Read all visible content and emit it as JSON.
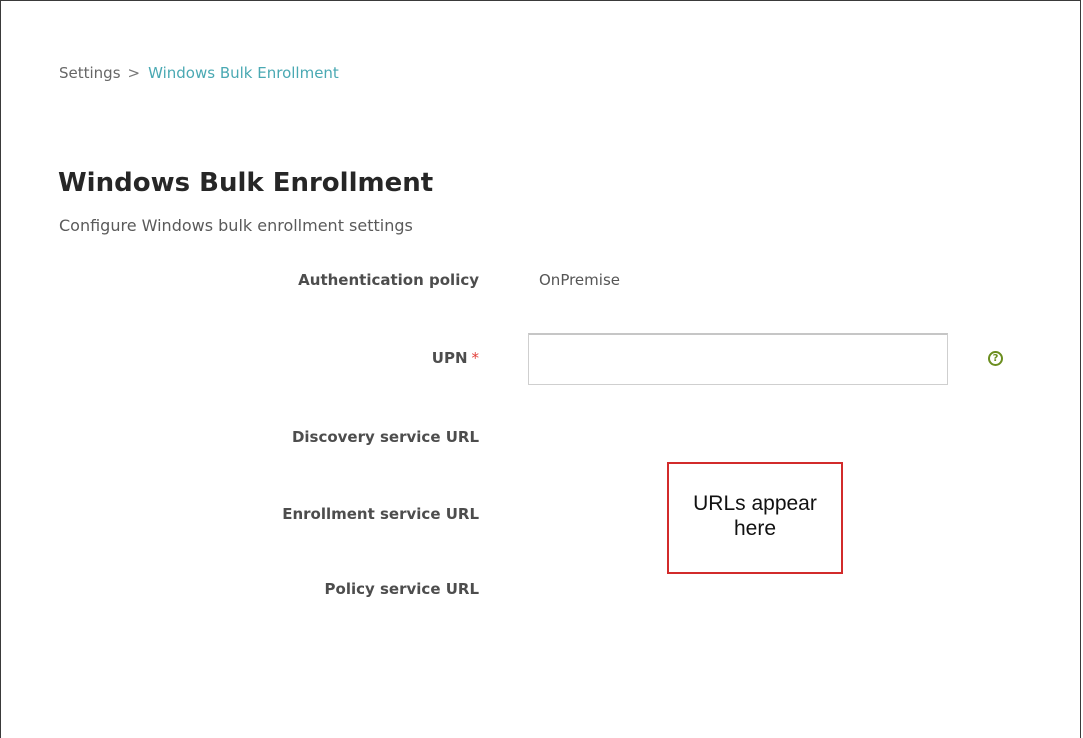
{
  "breadcrumb": {
    "parent": "Settings",
    "separator": ">",
    "current": "Windows Bulk Enrollment"
  },
  "page": {
    "title": "Windows Bulk Enrollment",
    "subtitle": "Configure Windows bulk enrollment settings"
  },
  "form": {
    "authentication_policy": {
      "label": "Authentication policy",
      "value": "OnPremise"
    },
    "upn": {
      "label": "UPN",
      "required_marker": "*",
      "value": "",
      "placeholder": "",
      "help_icon": "help-circle-icon",
      "help_glyph": "?"
    },
    "discovery_service_url": {
      "label": "Discovery service URL"
    },
    "enrollment_service_url": {
      "label": "Enrollment service URL"
    },
    "policy_service_url": {
      "label": "Policy service URL"
    }
  },
  "annotation": {
    "text": "URLs appear here",
    "border_color": "#d22b2b"
  },
  "colors": {
    "accent": "#4aa9b3",
    "required": "#e2413b",
    "help_icon": "#6b8e1f"
  }
}
